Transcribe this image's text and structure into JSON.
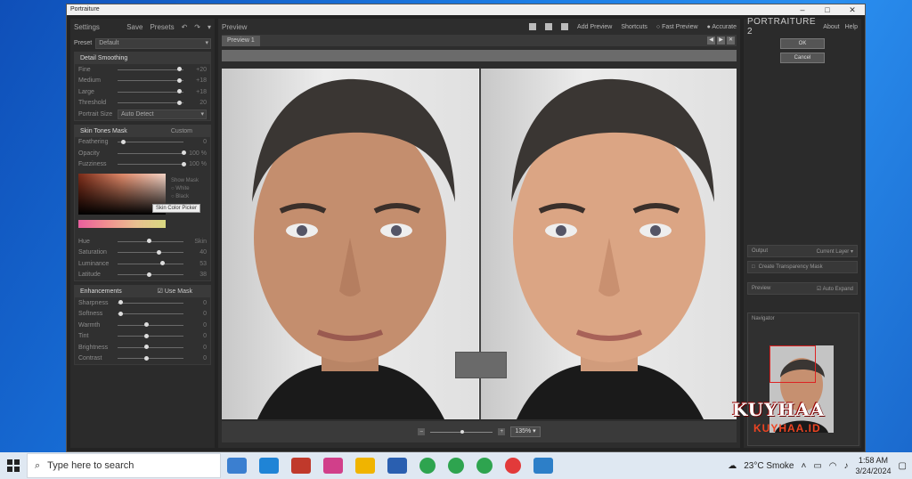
{
  "window": {
    "title": "Portraiture"
  },
  "left_panel": {
    "header": {
      "title": "Settings",
      "save": "Save",
      "presets": "Presets"
    },
    "preset": {
      "label": "Preset",
      "value": "Default"
    },
    "detail_smoothing": {
      "title": "Detail Smoothing",
      "sliders": [
        {
          "label": "Fine",
          "value": "+20",
          "level": 0.9
        },
        {
          "label": "Medium",
          "value": "+18",
          "level": 0.9
        },
        {
          "label": "Large",
          "value": "+18",
          "level": 0.9
        },
        {
          "label": "Threshold",
          "value": "20",
          "level": 0.9
        }
      ],
      "portrait_size": {
        "label": "Portrait Size",
        "value": "Auto Detect"
      }
    },
    "skin_mask": {
      "title": "Skin Tones Mask",
      "mode": "Custom",
      "sliders": [
        {
          "label": "Feathering",
          "value": "0",
          "level": 0.05
        },
        {
          "label": "Opacity",
          "value": "100 %",
          "level": 0.97
        },
        {
          "label": "Fuzziness",
          "value": "100 %",
          "level": 0.97
        }
      ],
      "show_mask_label": "Show Mask",
      "show_mask_options": [
        "White",
        "Black"
      ],
      "tooltip": "Skin Color Picker",
      "hsl": [
        {
          "label": "Hue",
          "value": "Skin",
          "level": 0.45
        },
        {
          "label": "Saturation",
          "value": "40",
          "level": 0.6
        },
        {
          "label": "Luminance",
          "value": "53",
          "level": 0.65
        },
        {
          "label": "Latitude",
          "value": "38",
          "level": 0.45
        }
      ]
    },
    "enhancements": {
      "title": "Enhancements",
      "use_mask": "Use Mask",
      "sliders": [
        {
          "label": "Sharpness",
          "value": "0",
          "level": 0.02
        },
        {
          "label": "Softness",
          "value": "0",
          "level": 0.02
        },
        {
          "label": "Warmth",
          "value": "0",
          "level": 0.4
        },
        {
          "label": "Tint",
          "value": "0",
          "level": 0.4
        },
        {
          "label": "Brightness",
          "value": "0",
          "level": 0.4
        },
        {
          "label": "Contrast",
          "value": "0",
          "level": 0.4
        }
      ]
    }
  },
  "preview": {
    "title": "Preview",
    "add_preview": "Add Preview",
    "shortcuts": "Shortcuts",
    "fast_preview": "Fast Preview",
    "accurate": "Accurate",
    "tab": "Preview 1",
    "zoom": "135%"
  },
  "right_panel": {
    "brand": "PORTRAITURE 2",
    "about": "About",
    "help": "Help",
    "ok": "OK",
    "cancel": "Cancel",
    "output_label": "Output",
    "output_value": "Current Layer",
    "transparency": "Create Transparency Mask",
    "preview_label": "Preview",
    "auto_expand": "Auto Expand",
    "navigator": "Navigator"
  },
  "watermark": {
    "line1": "KUYHAA",
    "line2": "KUYHAA.ID"
  },
  "taskbar": {
    "search_placeholder": "Type here to search",
    "weather": "23°C  Smoke",
    "time": "1:58 AM",
    "date": "3/24/2024"
  },
  "colors": {
    "taskbar": "#dfe8f2",
    "desktop": "#1f6fd6",
    "panel": "#2b2b2b"
  }
}
